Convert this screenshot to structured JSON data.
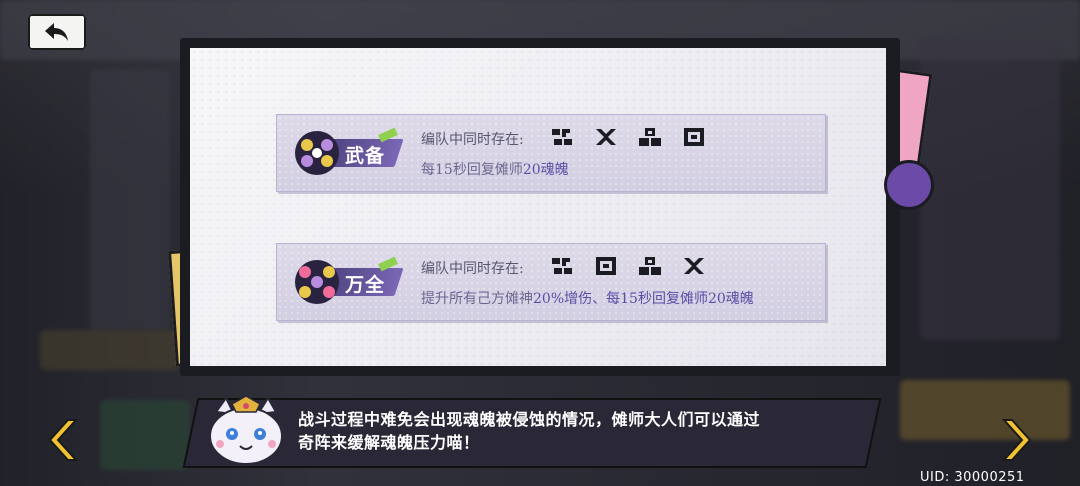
{
  "header": {
    "back_icon": "back-arrow-icon"
  },
  "combos": [
    {
      "name": "武备",
      "requirement_label": "编队中同时存在:",
      "requirement_icons": [
        "glyph-icon-1",
        "glyph-icon-2",
        "glyph-icon-3",
        "glyph-icon-4"
      ],
      "effect_prefix": "每15秒回复傩师",
      "effect_highlight": "20魂魄",
      "effect_suffix": ""
    },
    {
      "name": "万全",
      "requirement_label": "编队中同时存在:",
      "requirement_icons": [
        "glyph-icon-1",
        "glyph-icon-4",
        "glyph-icon-3",
        "glyph-icon-2"
      ],
      "effect_prefix": "提升所有己方傩神",
      "effect_highlight": "20%增伤",
      "effect_suffix": "、每15秒回复傩师20魂魄"
    }
  ],
  "dialog": {
    "line1": "战斗过程中难免会出现魂魄被侵蚀的情况，傩师大人们可以通过",
    "line2": "奇阵来缓解魂魄压力喵！"
  },
  "footer": {
    "uid": "UID: 30000251"
  },
  "colors": {
    "accent": "#5b4ea6",
    "arrow": "#f2c230",
    "panel_border": "#1b1b22"
  }
}
